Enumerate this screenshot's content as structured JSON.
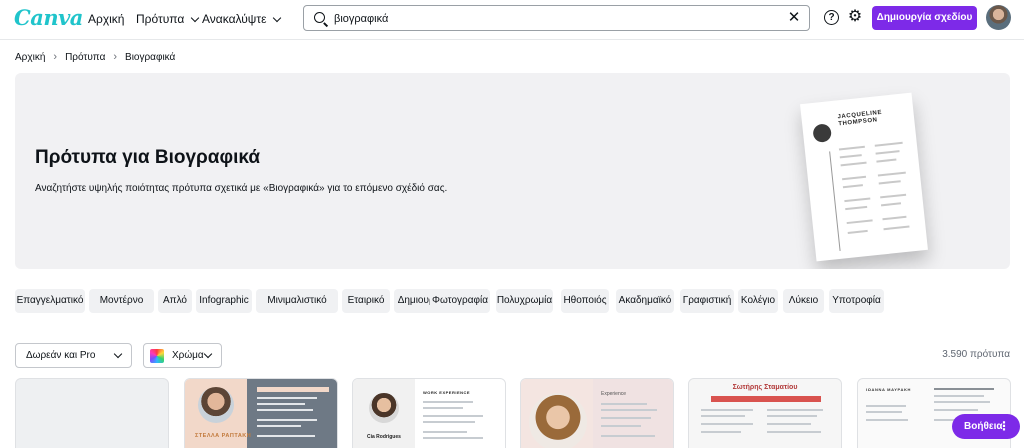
{
  "app": {
    "logo": "Canva"
  },
  "nav": {
    "home": "Αρχική",
    "templates": "Πρότυπα",
    "discover": "Ανακαλύψτε"
  },
  "search": {
    "value": "βιογραφικά"
  },
  "header": {
    "create_button": "Δημιουργία σχεδίου"
  },
  "breadcrumb": [
    "Αρχική",
    "Πρότυπα",
    "Βιογραφικά"
  ],
  "hero": {
    "title": "Πρότυπα για Βιογραφικά",
    "subtitle": "Αναζητήστε υψηλής ποιότητας πρότυπα σχετικά με «Βιογραφικά» για το επόμενο σχέδιό σας.",
    "preview_name": "JACQUELINE THOMPSON"
  },
  "tags": [
    "Επαγγελματικό",
    "Μοντέρνο",
    "Απλό",
    "Infographic",
    "Μινιμαλιστικό",
    "Εταιρικό",
    "Δημιουργικό",
    "Φωτογραφία",
    "Πολυχρωμία",
    "Ηθοποιός",
    "Ακαδημαϊκό",
    "Γραφιστική",
    "Κολέγιο",
    "Λύκειο",
    "Υποτροφία"
  ],
  "filters": {
    "price": "Δωρεάν και Pro",
    "color": "Χρώμα"
  },
  "result_count": "3.590 πρότυπα",
  "cards": {
    "card2_name": "ΣΤΕΛΛΑ ΡΑΠΤΑΚΗ",
    "card3_label": "WORK EXPERIENCE",
    "card3_name": "Cia Rodrigues",
    "card4_label": "Experience",
    "card5_name": "Σωτήρης Σταματίου",
    "card6_name": "ΙΩΑΝΝΑ ΜΑΥΡΑΚΗ"
  },
  "help_button": "Βοήθεια",
  "colors": {
    "accent": "#7d2ae8",
    "brand": "#20c4cb"
  }
}
